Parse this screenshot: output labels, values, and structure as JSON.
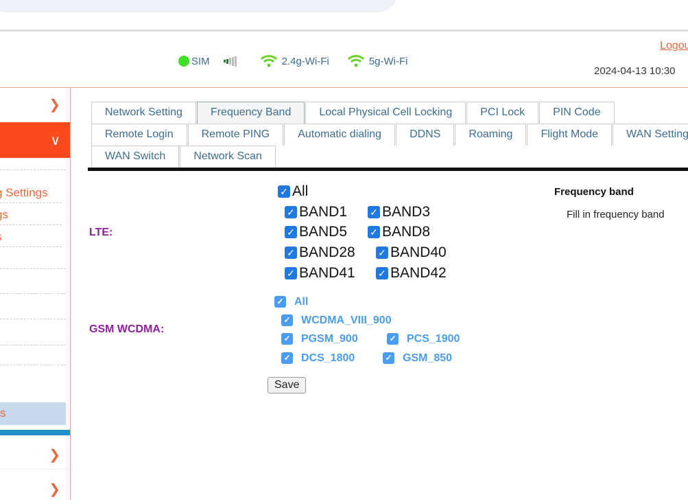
{
  "header": {
    "sim": "SIM",
    "wifi24": "2.4g-Wi-Fi",
    "wifi5": "5g-Wi-Fi",
    "logout": "Logout",
    "datetime": "2024-04-13 10:30",
    "colors": {
      "sim": "#3fe02a",
      "wifi": "#6bd12a",
      "accent": "#fb4a1c"
    }
  },
  "sidebar": {
    "items": [
      "g Settings",
      "gs",
      "s",
      "",
      "",
      "",
      "",
      "",
      ""
    ],
    "highlighted": "s"
  },
  "tabs": {
    "row1": [
      "Network Setting",
      "Frequency Band",
      "Local Physical Cell Locking",
      "PCI Lock",
      "PIN Code"
    ],
    "row2": [
      "Remote Login",
      "Remote PING",
      "Automatic dialing",
      "DDNS",
      "Roaming",
      "Flight Mode",
      "WAN Setting"
    ],
    "row3": [
      "WAN Switch",
      "Network Scan"
    ],
    "selected": "Frequency Band"
  },
  "lte": {
    "label": "LTE:",
    "all": "All",
    "bands": [
      "BAND1",
      "BAND3",
      "BAND5",
      "BAND8",
      "BAND28",
      "BAND40",
      "BAND41",
      "BAND42"
    ],
    "checked": true
  },
  "gsm": {
    "label": "GSM WCDMA:",
    "all": "All",
    "bands": [
      "WCDMA_VIII_900",
      "PGSM_900",
      "PCS_1900",
      "DCS_1800",
      "GSM_850"
    ],
    "checked": true
  },
  "help": {
    "title": "Frequency band",
    "desc": "Fill in frequency band"
  },
  "save": "Save"
}
